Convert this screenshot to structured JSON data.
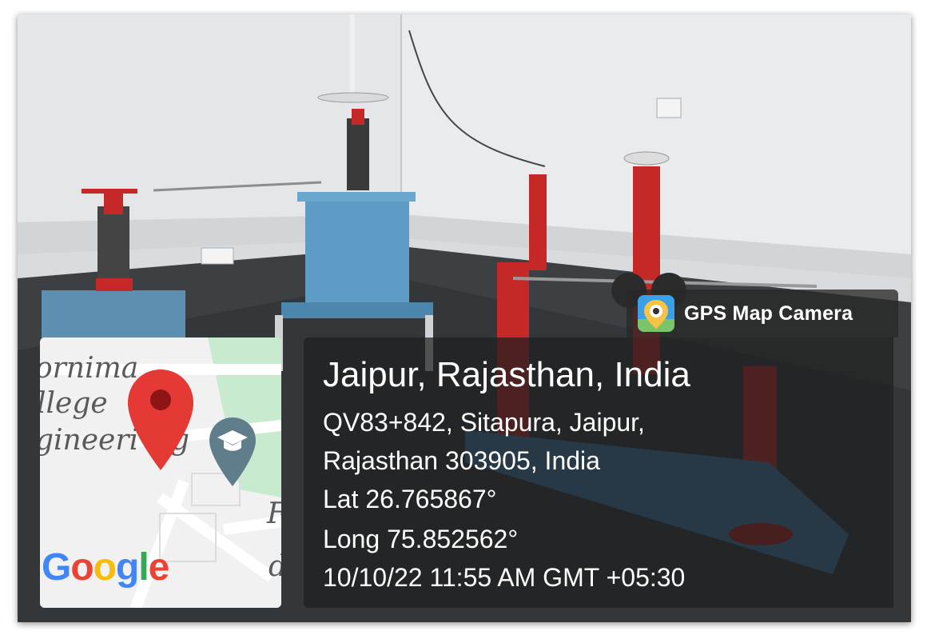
{
  "badge": {
    "label": "GPS Map Camera",
    "icon": "gps-map-camera-app-icon"
  },
  "location": {
    "title": "Jaipur, Rajasthan, India",
    "address_line1": "QV83+842, Sitapura, Jaipur,",
    "address_line2": "Rajasthan 303905, India",
    "lat": "Lat 26.765867°",
    "long": "Long 75.852562°",
    "datetime": "10/10/22 11:55 AM GMT +05:30"
  },
  "map": {
    "label_line1": "ornima",
    "label_line2": "llege",
    "label_line3": "gineeri",
    "label_line3_suffix": "g",
    "label_edge1": "F",
    "label_edge2": "d",
    "marker_icon": "location-pin-icon",
    "poi_icon": "graduation-cap-pin-icon",
    "attribution": {
      "G": "G",
      "o1": "o",
      "o2": "o",
      "g": "g",
      "l": "l",
      "e": "e"
    },
    "colors": {
      "blue": "#4285F4",
      "red": "#EA4335",
      "yellow": "#FBBC05",
      "green": "#34A853",
      "pin": "#E53935",
      "poi": "#607D8B",
      "park": "#c8ebd0"
    }
  }
}
